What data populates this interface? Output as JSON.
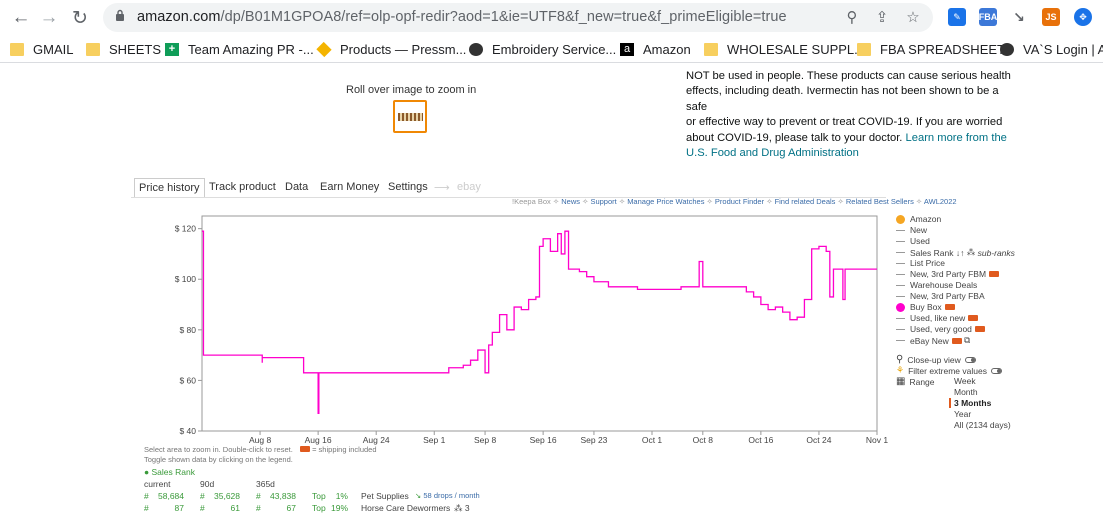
{
  "browser": {
    "url_main": "amazon.com",
    "url_path": "/dp/B01M1GPOA8/ref=olp-opf-redir?aod=1&ie=UTF8&f_new=true&f_primeEligible=true",
    "extensions": [
      {
        "name": "extension-blue-icon",
        "label": "",
        "color": "#1a73e8"
      },
      {
        "name": "extension-fba-icon",
        "label": "FBA",
        "color": "#3c78d8"
      },
      {
        "name": "extension-arrow-icon",
        "label": "",
        "color": "#5f6368"
      },
      {
        "name": "extension-js-icon",
        "label": "JS",
        "color": "#e8710a"
      },
      {
        "name": "extension-globe-icon",
        "label": "",
        "color": "#1a73e8"
      }
    ]
  },
  "bookmarks": [
    {
      "label": "GMAIL",
      "icon": "folder"
    },
    {
      "label": "SHEETS",
      "icon": "folder"
    },
    {
      "label": "Team Amazing PR -...",
      "icon": "sheets"
    },
    {
      "label": "Products — Pressm...",
      "icon": "diamond"
    },
    {
      "label": "Embroidery Service...",
      "icon": "globe"
    },
    {
      "label": "Amazon",
      "icon": "amazon"
    },
    {
      "label": "WHOLESALE SUPPL...",
      "icon": "folder"
    },
    {
      "label": "FBA SPREADSHEET",
      "icon": "folder"
    },
    {
      "label": "VA`S Login | AW",
      "icon": "globe"
    }
  ],
  "page": {
    "zoom_hint": "Roll over image to zoom in",
    "warning_lines": [
      "NOT be used in people. These products can cause serious health",
      "effects, including death. Ivermectin has not been shown to be a safe",
      "or effective way to prevent or treat COVID-19. If you are worried",
      "about COVID-19, please talk to your doctor."
    ],
    "warning_link_1": "Learn more from the",
    "warning_link_2": "U.S. Food and Drug Administration"
  },
  "keepa": {
    "tabs": [
      "Price history",
      "Track product",
      "Data",
      "Earn Money",
      "Settings"
    ],
    "ebay_label": "ebay",
    "links_prefix": "!Keepa Box",
    "links": [
      "News",
      "Support",
      "Manage Price Watches",
      "Product Finder",
      "Find related Deals",
      "Related Best Sellers",
      "AWL2022"
    ],
    "legend": [
      {
        "label": "Amazon",
        "marker": "dot",
        "color": "#f5a623"
      },
      {
        "label": "New",
        "marker": "dash"
      },
      {
        "label": "Used",
        "marker": "dash"
      },
      {
        "label": "Sales Rank",
        "marker": "dash",
        "extra": "sub-ranks"
      },
      {
        "label": "List Price",
        "marker": "dash"
      },
      {
        "label": "New, 3rd Party FBM",
        "marker": "dash",
        "truck": true
      },
      {
        "label": "Warehouse Deals",
        "marker": "dash"
      },
      {
        "label": "New, 3rd Party FBA",
        "marker": "dash"
      },
      {
        "label": "Buy Box",
        "marker": "dot",
        "color": "#ff00cc",
        "truck": true
      },
      {
        "label": "Used, like new",
        "marker": "dash",
        "truck": true
      },
      {
        "label": "Used, very good",
        "marker": "dash",
        "truck": true
      },
      {
        "label": "eBay New",
        "marker": "dash",
        "truck": true
      }
    ],
    "closeup_label": "Close-up view",
    "filter_label": "Filter extreme values",
    "range_label": "Range",
    "ranges": [
      "Week",
      "Month",
      "3 Months",
      "Year",
      "All (2134 days)"
    ],
    "selected_range": "3 Months",
    "footnote_1": "Select area to zoom in. Double-click to reset.",
    "footnote_ship": "= shipping included",
    "footnote_2": "Toggle shown data by clicking on the legend.",
    "sales_rank_title": "Sales Rank",
    "rank_headers": [
      "current",
      "90d",
      "365d"
    ],
    "rank_rows": [
      {
        "current": "58,684",
        "d90": "35,628",
        "d365": "43,838",
        "top": "Top",
        "pct": "1%",
        "category": "Pet Supplies",
        "extra": "58 drops / month"
      },
      {
        "current": "87",
        "d90": "61",
        "d365": "67",
        "top": "Top",
        "pct": "19%",
        "category": "Horse Care Dewormers",
        "extra": "3"
      }
    ]
  },
  "chart_data": {
    "type": "line",
    "title": "",
    "xlabel": "",
    "ylabel": "",
    "ylim": [
      40,
      125
    ],
    "yticks": [
      "$ 40",
      "$ 60",
      "$ 80",
      "$ 100",
      "$ 120"
    ],
    "ytick_values": [
      40,
      60,
      80,
      100,
      120
    ],
    "xticks": [
      "Aug 8",
      "Aug 16",
      "Aug 24",
      "Sep 1",
      "Sep 8",
      "Sep 16",
      "Sep 23",
      "Oct 1",
      "Oct 8",
      "Oct 16",
      "Oct 24",
      "Nov 1"
    ],
    "xtick_days": [
      8,
      16,
      24,
      32,
      39,
      47,
      54,
      62,
      69,
      77,
      85,
      93
    ],
    "xlim_days": [
      0,
      93
    ],
    "series": [
      {
        "name": "Buy Box",
        "color": "#ff00cc",
        "points": [
          [
            0,
            119
          ],
          [
            0.2,
            70
          ],
          [
            1.5,
            70
          ],
          [
            2.5,
            70
          ],
          [
            8.3,
            67
          ],
          [
            8.3,
            69
          ],
          [
            14,
            63
          ],
          [
            15,
            63
          ],
          [
            16,
            47
          ],
          [
            16.1,
            63
          ],
          [
            18,
            63
          ],
          [
            24,
            63
          ],
          [
            30,
            63
          ],
          [
            32,
            63
          ],
          [
            34,
            65
          ],
          [
            36,
            66
          ],
          [
            37,
            68
          ],
          [
            38,
            72
          ],
          [
            39,
            63
          ],
          [
            39.5,
            74
          ],
          [
            40,
            79
          ],
          [
            41,
            86
          ],
          [
            42,
            80
          ],
          [
            43,
            89
          ],
          [
            44,
            88
          ],
          [
            45,
            92
          ],
          [
            46,
            93
          ],
          [
            46.5,
            113
          ],
          [
            47,
            116
          ],
          [
            48,
            111
          ],
          [
            49,
            118
          ],
          [
            49.5,
            110
          ],
          [
            50,
            119
          ],
          [
            50.5,
            104
          ],
          [
            52,
            103
          ],
          [
            53,
            101
          ],
          [
            54,
            99
          ],
          [
            56,
            97
          ],
          [
            60,
            96
          ],
          [
            62,
            96
          ],
          [
            64,
            96
          ],
          [
            66,
            97
          ],
          [
            68,
            97
          ],
          [
            68.5,
            107
          ],
          [
            69,
            97
          ],
          [
            72,
            97
          ],
          [
            74,
            97
          ],
          [
            75,
            95
          ],
          [
            76,
            93
          ],
          [
            77,
            90
          ],
          [
            78,
            88
          ],
          [
            79,
            89
          ],
          [
            80,
            87
          ],
          [
            81,
            84
          ],
          [
            82,
            85
          ],
          [
            83,
            92
          ],
          [
            84,
            112
          ],
          [
            85,
            113
          ],
          [
            86,
            111
          ],
          [
            86.5,
            93
          ],
          [
            87,
            104
          ],
          [
            88,
            104
          ],
          [
            88.3,
            92
          ],
          [
            88.6,
            104
          ],
          [
            90,
            104
          ],
          [
            93,
            104
          ]
        ]
      }
    ]
  }
}
